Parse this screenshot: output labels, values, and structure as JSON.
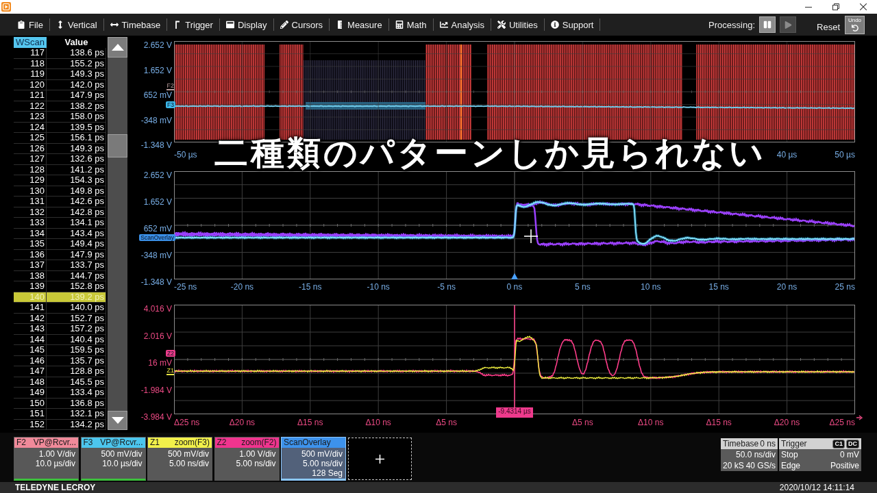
{
  "menu": {
    "items": [
      "File",
      "Vertical",
      "Timebase",
      "Trigger",
      "Display",
      "Cursors",
      "Measure",
      "Math",
      "Analysis",
      "Utilities",
      "Support"
    ]
  },
  "processing": {
    "label": "Processing:",
    "pause_disabled": false,
    "play_disabled": true
  },
  "reset": {
    "label": "Reset"
  },
  "undo": {
    "label": "Undo"
  },
  "table": {
    "columns": [
      {
        "label": "WScan",
        "selected": true
      },
      {
        "label": "Value",
        "selected": false
      }
    ],
    "rows": [
      {
        "wscan": "117",
        "value": "138.6 ps",
        "selected": false
      },
      {
        "wscan": "118",
        "value": "155.2 ps",
        "selected": false
      },
      {
        "wscan": "119",
        "value": "149.3 ps",
        "selected": false
      },
      {
        "wscan": "120",
        "value": "142.0 ps",
        "selected": false
      },
      {
        "wscan": "121",
        "value": "147.9 ps",
        "selected": false
      },
      {
        "wscan": "122",
        "value": "138.2 ps",
        "selected": false
      },
      {
        "wscan": "123",
        "value": "158.0 ps",
        "selected": false
      },
      {
        "wscan": "124",
        "value": "139.5 ps",
        "selected": false
      },
      {
        "wscan": "125",
        "value": "156.1 ps",
        "selected": false
      },
      {
        "wscan": "126",
        "value": "149.3 ps",
        "selected": false
      },
      {
        "wscan": "127",
        "value": "132.6 ps",
        "selected": false
      },
      {
        "wscan": "128",
        "value": "141.2 ps",
        "selected": false
      },
      {
        "wscan": "129",
        "value": "154.3 ps",
        "selected": false
      },
      {
        "wscan": "130",
        "value": "149.8 ps",
        "selected": false
      },
      {
        "wscan": "131",
        "value": "142.6 ps",
        "selected": false
      },
      {
        "wscan": "132",
        "value": "142.8 ps",
        "selected": false
      },
      {
        "wscan": "133",
        "value": "134.1 ps",
        "selected": false
      },
      {
        "wscan": "134",
        "value": "143.4 ps",
        "selected": false
      },
      {
        "wscan": "135",
        "value": "149.4 ps",
        "selected": false
      },
      {
        "wscan": "136",
        "value": "147.9 ps",
        "selected": false
      },
      {
        "wscan": "137",
        "value": "133.7 ps",
        "selected": false
      },
      {
        "wscan": "138",
        "value": "144.7 ps",
        "selected": false
      },
      {
        "wscan": "139",
        "value": "152.8 ps",
        "selected": false
      },
      {
        "wscan": "140",
        "value": "139.2 ps",
        "selected": true
      },
      {
        "wscan": "141",
        "value": "140.0 ps",
        "selected": false
      },
      {
        "wscan": "142",
        "value": "152.7 ps",
        "selected": false
      },
      {
        "wscan": "143",
        "value": "157.2 ps",
        "selected": false
      },
      {
        "wscan": "144",
        "value": "140.4 ps",
        "selected": false
      },
      {
        "wscan": "145",
        "value": "159.5 ps",
        "selected": false
      },
      {
        "wscan": "146",
        "value": "135.7 ps",
        "selected": false
      },
      {
        "wscan": "147",
        "value": "128.8 ps",
        "selected": false
      },
      {
        "wscan": "148",
        "value": "145.5 ps",
        "selected": false
      },
      {
        "wscan": "149",
        "value": "133.4 ps",
        "selected": false
      },
      {
        "wscan": "150",
        "value": "136.8 ps",
        "selected": false
      },
      {
        "wscan": "151",
        "value": "132.1 ps",
        "selected": false
      },
      {
        "wscan": "152",
        "value": "134.2 ps",
        "selected": false
      }
    ]
  },
  "panes": [
    {
      "kind": "overview",
      "y_labels": [
        "2.652 V",
        "1.652 V",
        "652 mV",
        "-348 mV",
        "-1.348 V"
      ],
      "x_labels_start": [
        "-50 µs"
      ],
      "x_labels_end": [
        "40 µs",
        "50 µs"
      ],
      "markers": [
        {
          "label": "F2",
          "kind": "text",
          "color": "#b89c9c"
        },
        {
          "label": "F3",
          "kind": "badge",
          "color": "#3cb8ea"
        }
      ]
    },
    {
      "kind": "overlay",
      "y_labels": [
        "2.652 V",
        "1.652 V",
        "652 mV",
        "-348 mV",
        "-1.348 V"
      ],
      "x_labels_start": [
        "-25 ns",
        "-20 ns",
        "-15 ns",
        "-10 ns",
        "-5 ns",
        "0 ns",
        "5 ns",
        "10 ns",
        "15 ns",
        "20 ns",
        "25 ns"
      ],
      "markers": [
        {
          "label": "ScanOverlay",
          "kind": "badge",
          "color": "#3a8fe6"
        }
      ]
    },
    {
      "kind": "zoom",
      "y_labels": [
        "4.016 V",
        "2.016 V",
        "16 mV",
        "-1.984 V",
        "-3.984 V"
      ],
      "x_labels_start": [
        "Δ25 ns",
        "Δ20 ns",
        "Δ15 ns",
        "Δ10 ns",
        "Δ5 ns"
      ],
      "x_labels_end": [
        "Δ5 ns",
        "Δ10 ns",
        "Δ15 ns",
        "Δ20 ns",
        "Δ25 ns"
      ],
      "cursor_readout": "-9.4314 µs",
      "markers": [
        {
          "label": "Z2",
          "kind": "badge",
          "color": "#ec3c8a"
        },
        {
          "label": "Z1",
          "kind": "text",
          "color": "#e8e444"
        }
      ]
    }
  ],
  "caption": {
    "text": "二種類のパターンしか見られない"
  },
  "channels": [
    {
      "name": "F2",
      "source": "VP@Rcvr...",
      "color": "#f08a9a",
      "lines": [
        "1.00 V/div",
        "10.0 µs/div"
      ],
      "selected": false,
      "active": true
    },
    {
      "name": "F3",
      "source": "VP@Rcvr...",
      "color": "#4cc6ee",
      "lines": [
        "500 mV/div",
        "10.0 µs/div"
      ],
      "selected": false,
      "active": true
    },
    {
      "name": "Z1",
      "source": "zoom(F3)",
      "color": "#f2f04a",
      "lines": [
        "500 mV/div",
        "5.00 ns/div"
      ],
      "selected": false,
      "active": false
    },
    {
      "name": "Z2",
      "source": "zoom(F2)",
      "color": "#f0348e",
      "lines": [
        "1.00 V/div",
        "5.00 ns/div"
      ],
      "selected": false,
      "active": false
    },
    {
      "name": "ScanOverlay",
      "color": "#3d92ec",
      "lines": [
        "500 mV/div",
        "5.00 ns/div",
        "128 Seg"
      ],
      "selected": true,
      "active": false
    }
  ],
  "timebase": {
    "label": "Timebase",
    "delay": "0 ns",
    "scale": "50.0 ns/div",
    "samples": "20 kS",
    "rate": "40 GS/s"
  },
  "trigger": {
    "label": "Trigger",
    "tags": [
      "C1",
      "DC"
    ],
    "mode": "Stop",
    "threshold": "0 mV",
    "type": "Edge",
    "slope": "Positive"
  },
  "status_bar": {
    "brand": "TELEDYNE LECROY",
    "datetime": "2020/10/12 14:11:14"
  }
}
